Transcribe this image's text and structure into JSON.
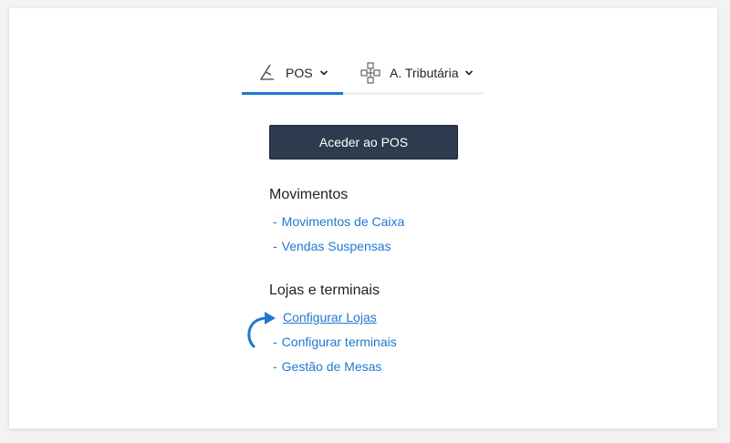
{
  "tabs": [
    {
      "label": "POS",
      "icon": "pos-icon",
      "active": true
    },
    {
      "label": "A. Tributária",
      "icon": "tax-authority-icon",
      "active": false
    }
  ],
  "access_button": "Aceder ao POS",
  "sections": [
    {
      "title": "Movimentos",
      "links": [
        "Movimentos de Caixa",
        "Vendas Suspensas"
      ]
    },
    {
      "title": "Lojas e terminais",
      "links": [
        "Configurar Lojas",
        "Configurar terminais",
        "Gestão de Mesas"
      ]
    }
  ],
  "dash": "-",
  "colors": {
    "accent": "#1f78d1",
    "button": "#2e3a4e",
    "arrow": "#1f78d1"
  }
}
